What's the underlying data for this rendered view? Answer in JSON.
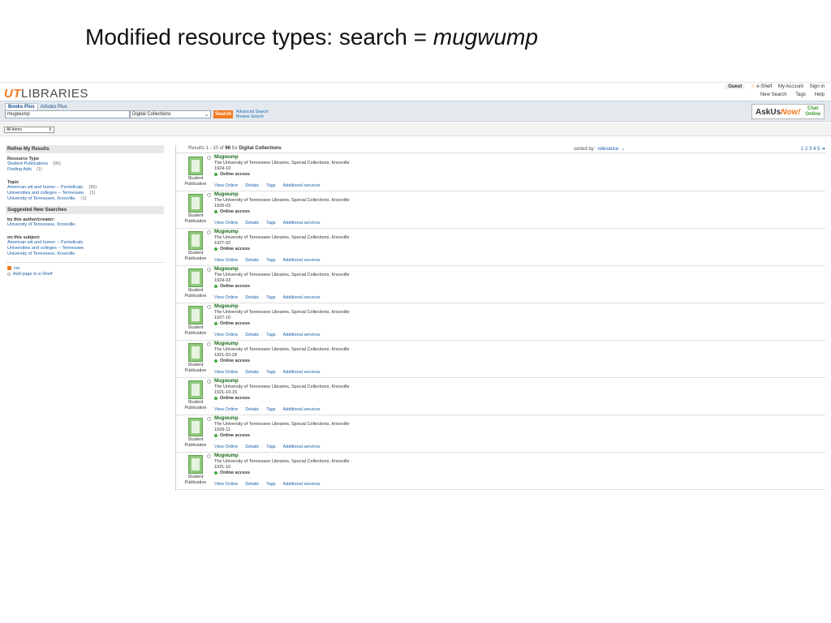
{
  "slide": {
    "title_prefix": "Modified resource types:  search = ",
    "title_term": "mugwump"
  },
  "header": {
    "logo_ut": "UT",
    "logo_libraries": "LIBRARIES",
    "guest": "Guest",
    "eshelf": "e-Shelf",
    "my_account": "My Account",
    "sign_in": "Sign in",
    "new_search": "New Search",
    "tags": "Tags",
    "help": "Help"
  },
  "search": {
    "tabs": [
      "Books Plus",
      "Articles Plus"
    ],
    "query": "mugwump",
    "scope": "Digital Collections",
    "button": "Search",
    "advanced": "Advanced Search",
    "browse": "Browse Search"
  },
  "askus": {
    "ask": "AskUs",
    "now": "Now!",
    "chat1": "Chat",
    "chat2": "Online"
  },
  "filter": {
    "all_items": "All items"
  },
  "sidebar": {
    "refine_heading": "Refine My Results",
    "resource_type_label": "Resource Type",
    "resource_types": [
      {
        "label": "Student Publications",
        "count": "(95)"
      },
      {
        "label": "Finding Aids",
        "count": "(1)"
      }
    ],
    "topic_label": "Topic",
    "topics": [
      {
        "label": "American wit and humor -- Periodicals.",
        "count": "(95)"
      },
      {
        "label": "Universities and colleges -- Tennessee.",
        "count": "(1)"
      },
      {
        "label": "University of Tennessee, Knoxville.",
        "count": "(1)"
      }
    ],
    "suggested_heading": "Suggested New Searches",
    "by_author_label": "by this author/creator:",
    "by_author": [
      "University of Tennessee, Knoxville."
    ],
    "on_subject_label": "on this subject:",
    "on_subject": [
      "American wit and humor -- Periodicals.",
      "Universities and colleges -- Tennessee.",
      "University of Tennessee, Knoxville."
    ],
    "rss": "rss",
    "add_page": "Add page to e-Shelf"
  },
  "results_header": {
    "prefix": "Results 1 - 10 of ",
    "total": "96",
    "for_label": " for ",
    "scope": "Digital Collections",
    "sorted_by": "sorted by:",
    "sort_value": "relevance",
    "pages": "1 2 3 4 5 ➔"
  },
  "results": [
    {
      "type1": "Student",
      "type2": "Publication",
      "title": "Mugwump",
      "source": "The University of Tennessee Libraries, Special Collections, Knoxville",
      "date": "1924-10",
      "access": "Online access",
      "actions": [
        "View Online",
        "Details",
        "Tags",
        "Additional services"
      ]
    },
    {
      "type1": "Student",
      "type2": "Publication",
      "title": "Mugwump",
      "source": "The University of Tennessee Libraries, Special Collections, Knoxville",
      "date": "1926-03",
      "access": "Online access",
      "actions": [
        "View Online",
        "Details",
        "Tags",
        "Additional services"
      ]
    },
    {
      "type1": "Student",
      "type2": "Publication",
      "title": "Mugwump",
      "source": "The University of Tennessee Libraries, Special Collections, Knoxville",
      "date": "1927-02",
      "access": "Online access",
      "actions": [
        "View Online",
        "Details",
        "Tags",
        "Additional services"
      ]
    },
    {
      "type1": "Student",
      "type2": "Publication",
      "title": "Mugwump",
      "source": "The University of Tennessee Libraries, Special Collections, Knoxville",
      "date": "1924-03",
      "access": "Online access",
      "actions": [
        "View Online",
        "Details",
        "Tags",
        "Additional services"
      ]
    },
    {
      "type1": "Student",
      "type2": "Publication",
      "title": "Mugwump",
      "source": "The University of Tennessee Libraries, Special Collections, Knoxville",
      "date": "1927-10",
      "access": "Online access",
      "actions": [
        "View Online",
        "Details",
        "Tags",
        "Additional services"
      ]
    },
    {
      "type1": "Student",
      "type2": "Publication",
      "title": "Mugwump",
      "source": "The University of Tennessee Libraries, Special Collections, Knoxville",
      "date": "1921-02-28",
      "access": "Online access",
      "actions": [
        "View Online",
        "Details",
        "Tags",
        "Additional services"
      ]
    },
    {
      "type1": "Student",
      "type2": "Publication",
      "title": "Mugwump",
      "source": "The University of Tennessee Libraries, Special Collections, Knoxville",
      "date": "1921-10-15",
      "access": "Online access",
      "actions": [
        "View Online",
        "Details",
        "Tags",
        "Additional services"
      ]
    },
    {
      "type1": "Student",
      "type2": "Publication",
      "title": "Mugwump",
      "source": "The University of Tennessee Libraries, Special Collections, Knoxville",
      "date": "1929-11",
      "access": "Online access",
      "actions": [
        "View Online",
        "Details",
        "Tags",
        "Additional services"
      ]
    },
    {
      "type1": "Student",
      "type2": "Publication",
      "title": "Mugwump",
      "source": "The University of Tennessee Libraries, Special Collections, Knoxville",
      "date": "1931-10",
      "access": "Online access",
      "actions": [
        "View Online",
        "Details",
        "Tags",
        "Additional services"
      ]
    }
  ]
}
